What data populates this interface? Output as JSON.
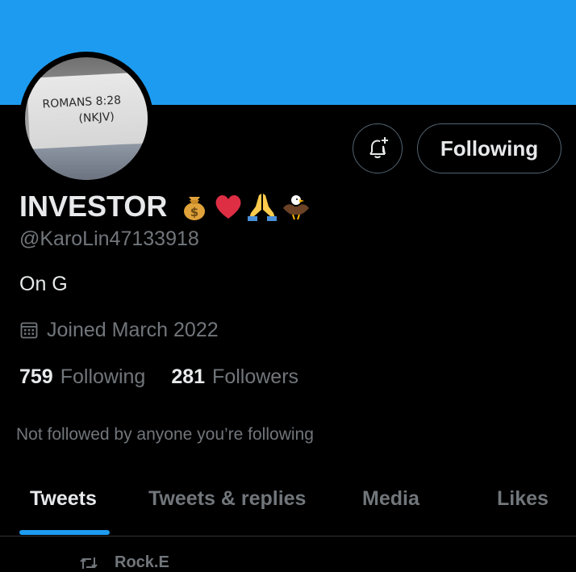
{
  "avatar": {
    "line1": "ROMANS 8:28",
    "line2": "(NKJV)"
  },
  "bell_button": {
    "icon": "bell-plus-icon"
  },
  "follow_button": {
    "label": "Following"
  },
  "profile": {
    "display_name": "INVESTOR",
    "name_emoji": [
      "money-bag",
      "red-heart",
      "folded-hands",
      "eagle"
    ],
    "handle": "@KaroLin47133918",
    "bio": "On G",
    "joined": "Joined March 2022",
    "joined_icon": "calendar-icon"
  },
  "stats": {
    "following_count": "759",
    "following_label": "Following",
    "followers_count": "281",
    "followers_label": "Followers"
  },
  "not_followed_text": "Not followed by anyone you’re following",
  "tabs": [
    {
      "label": "Tweets",
      "active": true
    },
    {
      "label": "Tweets & replies",
      "active": false
    },
    {
      "label": "Media",
      "active": false
    },
    {
      "label": "Likes",
      "active": false
    }
  ],
  "peek_row": {
    "icon": "retweet-icon",
    "text": "Rock.E"
  },
  "colors": {
    "banner": "#1d9bf0",
    "background": "#000000",
    "primary_text": "#e7e9ea",
    "secondary_text": "#71767b",
    "accent": "#1d9bf0",
    "border": "#536471"
  }
}
